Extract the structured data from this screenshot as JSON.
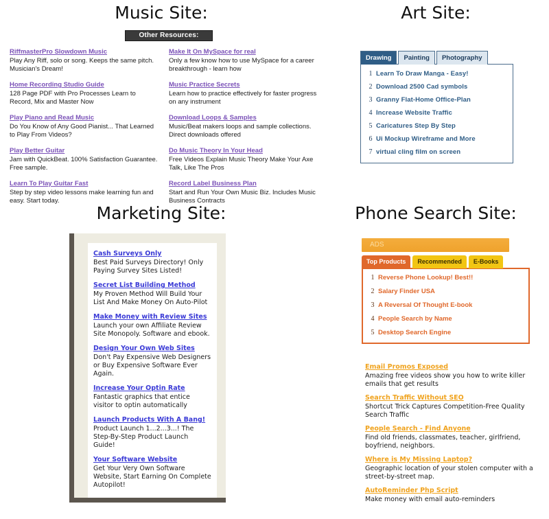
{
  "music_site": {
    "title": "Music Site:",
    "banner": "Other Resources:",
    "link_color": "#7b52b8",
    "left_column": [
      {
        "link": "RiffmasterPro Slowdown Music",
        "desc": "Play Any Riff, solo or song. Keeps the same pitch. Musician's Dream!"
      },
      {
        "link": "Home Recording Studio Guide",
        "desc": "128 Page PDF with Pro Processes Learn to Record, Mix and Master Now"
      },
      {
        "link": "Play Piano and Read Music",
        "desc": "Do You Know of Any Good Pianist... That Learned to Play From Videos?"
      },
      {
        "link": "Play Better Guitar",
        "desc": "Jam with QuickBeat. 100% Satisfaction Guarantee. Free sample."
      },
      {
        "link": "Learn To Play Guitar Fast",
        "desc": "Step by step video lessons make learning fun and easy. Start today."
      }
    ],
    "right_column": [
      {
        "link": "Make It On MySpace for real",
        "desc": "Only a few know how to use MySpace for a career breakthrough - learn how"
      },
      {
        "link": "Music Practice Secrets",
        "desc": "Learn how to practice effectively for faster progress on any instrument"
      },
      {
        "link": "Download Loops & Samples",
        "desc": "Music/Beat makers loops and sample collections. Direct downloads offered"
      },
      {
        "link": "Do Music Theory In Your Head",
        "desc": "Free Videos Explain Music Theory Make Your Axe Talk, Like The Pros"
      },
      {
        "link": "Record Label Business Plan",
        "desc": "Start and Run Your Own Music Biz. Includes Music Business Contracts"
      }
    ]
  },
  "art_site": {
    "title": "Art Site:",
    "accent_color": "#2f5d86",
    "tabs": [
      {
        "label": "Drawing",
        "active": true
      },
      {
        "label": "Painting",
        "active": false
      },
      {
        "label": "Photography",
        "active": false
      }
    ],
    "items": [
      {
        "num": "1",
        "link": "Learn To Draw Manga - Easy!"
      },
      {
        "num": "2",
        "link": "Download 2500 Cad symbols"
      },
      {
        "num": "3",
        "link": "Granny Flat-Home Office-Plan"
      },
      {
        "num": "4",
        "link": "Increase Website Traffic"
      },
      {
        "num": "5",
        "link": "Caricatures Step By Step"
      },
      {
        "num": "6",
        "link": "Ui Mockup Wireframe and More"
      },
      {
        "num": "7",
        "link": "virtual cling film on screen"
      }
    ]
  },
  "marketing_site": {
    "title": "Marketing Site:",
    "link_color": "#3a3ad6",
    "items": [
      {
        "link": "Cash Surveys Only",
        "desc": "Best Paid Surveys Directory! Only Paying Survey Sites Listed!"
      },
      {
        "link": "Secret List Building Method",
        "desc": "My Proven Method Will Build Your List And Make Money On Auto-Pilot"
      },
      {
        "link": "Make Money with Review Sites",
        "desc": "Launch your own Affiliate Review Site Monopoly. Software and ebook."
      },
      {
        "link": "Design Your Own Web Sites",
        "desc": "Don't Pay Expensive Web Designers or Buy Expensive Software Ever Again."
      },
      {
        "link": "Increase Your Optin Rate",
        "desc": "Fantastic graphics that entice visitor to optin automatically"
      },
      {
        "link": "Launch Products With A Bang!",
        "desc": "Product Launch 1...2...3...! The Step-By-Step Product Launch Guide!"
      },
      {
        "link": "Your Software Website",
        "desc": "Get Your Very Own Software Website, Start Earning On Complete Autopilot!"
      }
    ]
  },
  "phone_search_site": {
    "title": "Phone Search Site:",
    "ads_label": "ADS",
    "accent_color": "#e0682b",
    "tabs": [
      {
        "label": "Top Products",
        "active": true
      },
      {
        "label": "Recommended",
        "active": false
      },
      {
        "label": "E-Books",
        "active": false
      }
    ],
    "ranked_items": [
      {
        "num": "1",
        "link": "Reverse Phone Lookup! Best!!"
      },
      {
        "num": "2",
        "link": "Salary Finder USA"
      },
      {
        "num": "3",
        "link": "A Reversal Of Thought E-book"
      },
      {
        "num": "4",
        "link": "People Search by Name"
      },
      {
        "num": "5",
        "link": "Desktop Search Engine"
      }
    ],
    "items": [
      {
        "link": "Email Promos Exposed",
        "desc": "Amazing free videos show you how to write killer emails that get results"
      },
      {
        "link": "Search Traffic Without SEO",
        "desc": "Shortcut Trick Captures Competition-Free Quality Search Traffic"
      },
      {
        "link": "People Search - Find Anyone",
        "desc": "Find old friends, classmates, teacher, girlfriend, boyfriend, neighbors."
      },
      {
        "link": "Where is My Missing Laptop?",
        "desc": "Geographic location of your stolen computer with a street-by-street map."
      },
      {
        "link": "AutoReminder Php Script",
        "desc": "Make money with email auto-reminders"
      }
    ]
  }
}
